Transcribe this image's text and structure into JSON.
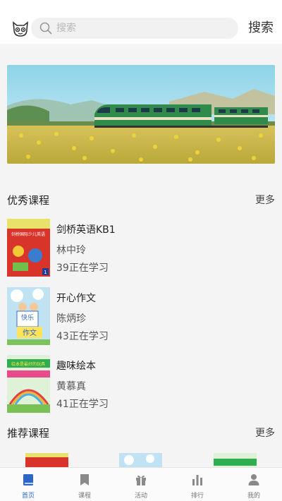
{
  "header": {
    "search_placeholder": "搜索",
    "search_button": "搜索"
  },
  "sections": {
    "excellent_title": "优秀课程",
    "excellent_more": "更多",
    "recommended_title": "推荐课程",
    "recommended_more": "更多"
  },
  "courses": [
    {
      "name": "剑桥英语KB1",
      "teacher": "林中玲",
      "learners": "39正在学习",
      "cover_text": "剑桥国际少儿英语",
      "cover_badge": "1"
    },
    {
      "name": "开心作文",
      "teacher": "陈炳珍",
      "learners": "43正在学习",
      "cover_text_top": "快乐",
      "cover_text_bottom": "作文"
    },
    {
      "name": "趣味绘本",
      "teacher": "黄慕真",
      "learners": "41正在学习",
      "cover_text": "绘本是最好的玩具"
    }
  ],
  "tabs": [
    {
      "label": "首页",
      "icon": "home-book-icon",
      "active": true
    },
    {
      "label": "课程",
      "icon": "bookmark-icon",
      "active": false
    },
    {
      "label": "活动",
      "icon": "gift-icon",
      "active": false
    },
    {
      "label": "排行",
      "icon": "bar-chart-icon",
      "active": false
    },
    {
      "label": "我的",
      "icon": "person-icon",
      "active": false
    }
  ],
  "colors": {
    "accent": "#2c67c6",
    "background": "#f4f4f4"
  }
}
